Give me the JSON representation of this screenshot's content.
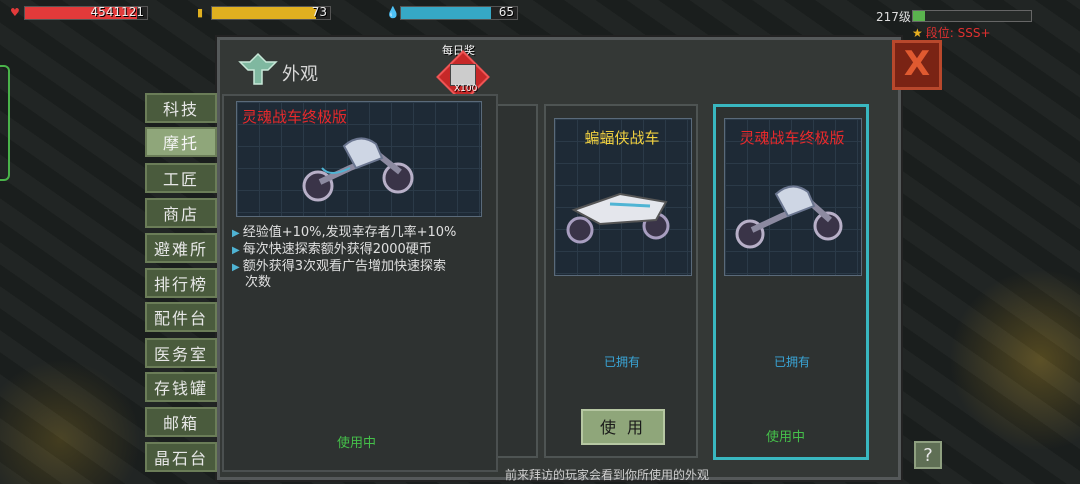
{
  "hud": {
    "hp_value": "4541121",
    "energy_value": "73",
    "water_value": "65",
    "hp_fill": 0.92,
    "energy_fill": 0.88,
    "water_fill": 0.78,
    "level_text": "217级",
    "level_fill": 0.12,
    "rank_text": "段位: SSS+"
  },
  "panel": {
    "title": "外观",
    "daily_label": "每日奖",
    "daily_count": "X100",
    "footer_note": "前来拜访的玩家会看到你所使用的外观",
    "help_label": "?",
    "close_label": "X"
  },
  "tabs": [
    {
      "label": "科技"
    },
    {
      "label": "摩托"
    },
    {
      "label": "工匠"
    },
    {
      "label": "商店"
    },
    {
      "label": "避难所"
    },
    {
      "label": "排行榜"
    },
    {
      "label": "配件台"
    },
    {
      "label": "医务室"
    },
    {
      "label": "存钱罐"
    },
    {
      "label": "邮箱"
    },
    {
      "label": "晶石台"
    }
  ],
  "active_tab": "摩托",
  "detail": {
    "name": "灵魂战车终极版",
    "desc": [
      "经验值+10%,发现幸存者几率+10%",
      "每次快速探索额外获得2000硬币",
      "额外获得3次观看广告增加快速探索",
      "次数"
    ],
    "status": "使用中"
  },
  "cards": [
    {
      "name": "蝙蝠侠战车",
      "status": "已拥有",
      "button": "使 用"
    },
    {
      "name": "灵魂战车终极版",
      "status": "已拥有",
      "state": "使用中"
    }
  ],
  "colors": {
    "hp": "#e23a3a",
    "energy": "#e0b020",
    "water": "#36a8c6",
    "name_red": "#e8292b",
    "name_yellow": "#f0d040",
    "selected_border": "#39b7c0",
    "in_use_green": "#45c04a"
  },
  "icons": [
    "heart-icon",
    "energy-icon",
    "water-drop-icon",
    "star-icon",
    "outfit-icon",
    "gift-box-icon",
    "close-icon",
    "help-icon"
  ]
}
